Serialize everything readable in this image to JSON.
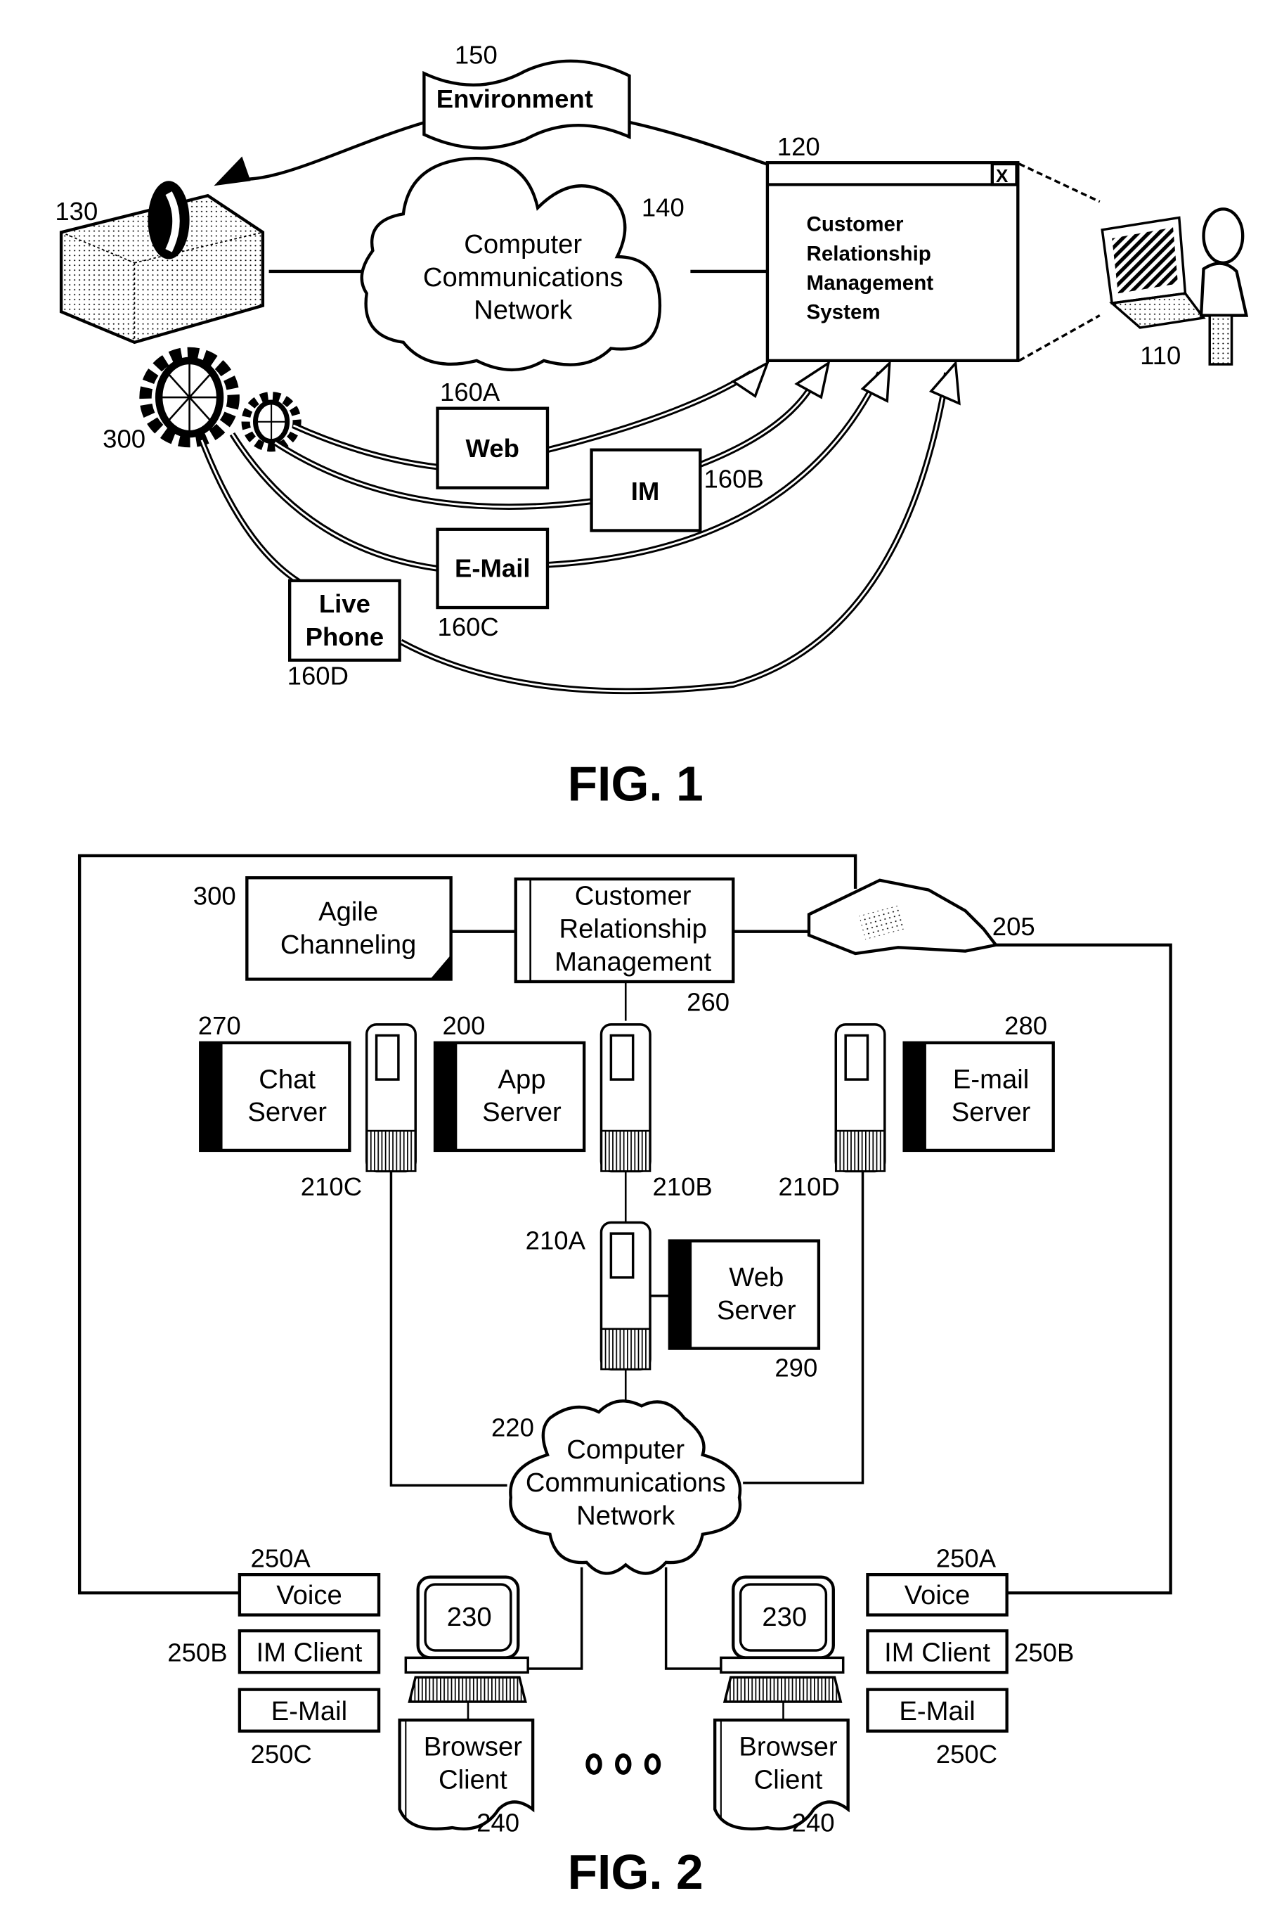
{
  "fig1": {
    "caption": "FIG. 1",
    "environment": {
      "ref": "150",
      "label": "Environment"
    },
    "crm_system": {
      "ref": "120",
      "lines": [
        "Customer",
        "Relationship",
        "Management",
        "System"
      ],
      "close_glyph": "X"
    },
    "network": {
      "ref": "140",
      "lines": [
        "Computer",
        "Communications",
        "Network"
      ]
    },
    "contact_center": {
      "ref": "130"
    },
    "user": {
      "ref": "110"
    },
    "agile_channeling": {
      "ref": "300"
    },
    "channels": [
      {
        "ref": "160A",
        "label": [
          "Web"
        ]
      },
      {
        "ref": "160B",
        "label": [
          "IM"
        ]
      },
      {
        "ref": "160C",
        "label": [
          "E-Mail"
        ]
      },
      {
        "ref": "160D",
        "label": [
          "Live",
          "Phone"
        ]
      }
    ]
  },
  "fig2": {
    "caption": "FIG. 2",
    "agile_channeling": {
      "ref": "300",
      "lines": [
        "Agile",
        "Channeling"
      ]
    },
    "crm": {
      "ref": "260",
      "lines": [
        "Customer",
        "Relationship",
        "Management"
      ]
    },
    "phone": {
      "ref": "205"
    },
    "chat_server": {
      "ref": "270",
      "lines": [
        "Chat",
        "Server"
      ],
      "host_ref": "210C"
    },
    "app_server": {
      "ref": "200",
      "lines": [
        "App",
        "Server"
      ],
      "host_ref": "210B"
    },
    "email_server": {
      "ref": "280",
      "lines": [
        "E-mail",
        "Server"
      ],
      "host_ref": "210D"
    },
    "web_server": {
      "ref": "290",
      "lines": [
        "Web",
        "Server"
      ],
      "host_ref": "210A"
    },
    "network": {
      "ref": "220",
      "lines": [
        "Computer",
        "Communications",
        "Network"
      ]
    },
    "clients": [
      {
        "computer_ref": "230",
        "browser": {
          "ref": "240",
          "lines": [
            "Browser",
            "Client"
          ]
        },
        "channels": [
          {
            "ref": "250A",
            "label": "Voice"
          },
          {
            "ref": "250B",
            "label": "IM Client"
          },
          {
            "ref": "250C",
            "label": "E-Mail"
          }
        ]
      },
      {
        "computer_ref": "230",
        "browser": {
          "ref": "240",
          "lines": [
            "Browser",
            "Client"
          ]
        },
        "channels": [
          {
            "ref": "250A",
            "label": "Voice"
          },
          {
            "ref": "250B",
            "label": "IM Client"
          },
          {
            "ref": "250C",
            "label": "E-Mail"
          }
        ]
      }
    ],
    "ellipsis": "ooo"
  }
}
